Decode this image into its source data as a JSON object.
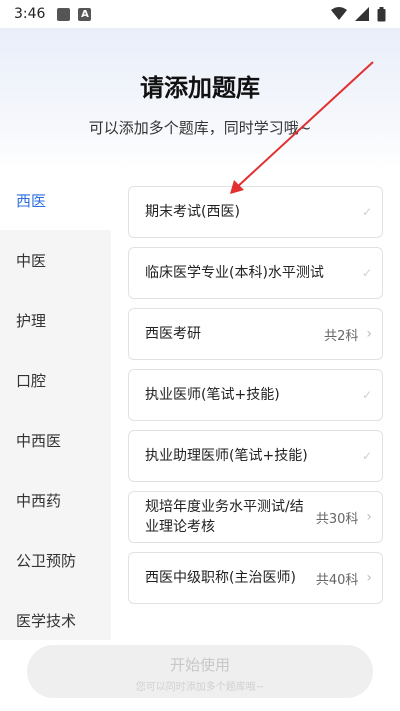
{
  "status": {
    "time": "3:46"
  },
  "header": {
    "title": "请添加题库",
    "subtitle": "可以添加多个题库，同时学习哦~"
  },
  "sidebar": {
    "items": [
      {
        "label": "西医",
        "active": true
      },
      {
        "label": "中医"
      },
      {
        "label": "护理"
      },
      {
        "label": "口腔"
      },
      {
        "label": "中西医"
      },
      {
        "label": "中西药"
      },
      {
        "label": "公卫预防"
      },
      {
        "label": "医学技术"
      }
    ]
  },
  "list": {
    "items": [
      {
        "title": "期末考试(西医)",
        "meta": "",
        "indicator": "check"
      },
      {
        "title": "临床医学专业(本科)水平测试",
        "meta": "",
        "indicator": "check"
      },
      {
        "title": "西医考研",
        "meta": "共2科",
        "indicator": "chevron"
      },
      {
        "title": "执业医师(笔试+技能)",
        "meta": "",
        "indicator": "check"
      },
      {
        "title": "执业助理医师(笔试+技能)",
        "meta": "",
        "indicator": "check"
      },
      {
        "title": "规培年度业务水平测试/结业理论考核",
        "meta": "共30科",
        "indicator": "chevron"
      },
      {
        "title": "西医中级职称(主治医师)",
        "meta": "共40科",
        "indicator": "chevron"
      }
    ]
  },
  "footer": {
    "button_label": "开始使用",
    "hint": "您可以同时添加多个题库哦~"
  },
  "colors": {
    "accent": "#2f6fe0",
    "annotation": "#e03030"
  }
}
